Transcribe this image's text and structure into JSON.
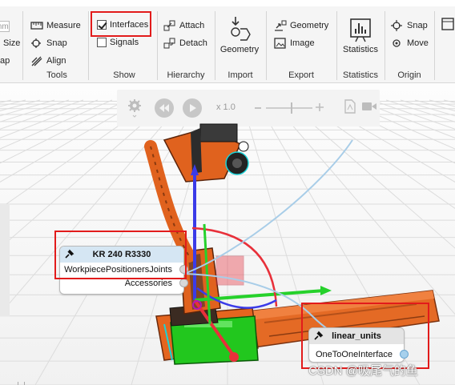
{
  "ribbon": {
    "partial": {
      "size_label": "Size",
      "map_label": "ap",
      "mm_value": "mm"
    },
    "tools": {
      "group_label": "Tools",
      "measure": "Measure",
      "snap": "Snap",
      "align": "Align"
    },
    "show": {
      "group_label": "Show",
      "interfaces": "Interfaces",
      "interfaces_checked": true,
      "signals": "Signals",
      "signals_checked": false
    },
    "hierarchy": {
      "group_label": "Hierarchy",
      "attach": "Attach",
      "detach": "Detach"
    },
    "import": {
      "group_label": "Import",
      "geometry": "Geometry"
    },
    "export": {
      "group_label": "Export",
      "geometry": "Geometry",
      "image": "Image"
    },
    "statistics": {
      "group_label": "Statistics",
      "statistics": "Statistics"
    },
    "origin": {
      "group_label": "Origin",
      "snap": "Snap",
      "move": "Move"
    }
  },
  "playback": {
    "speed": "x 1.0",
    "slider_fraction": 0.55
  },
  "nodes": {
    "robot": {
      "title": "KR 240 R3330",
      "rows": [
        "WorkpiecePositionersJoints",
        "Accessories"
      ]
    },
    "linear": {
      "title": "linear_units",
      "rows": [
        "OneToOneInterface"
      ]
    }
  },
  "watermark": "CSDN @吸尾气的鱼",
  "colors": {
    "highlight": "#e21b1b",
    "robot_orange": "#e0621e",
    "base_green": "#22c71e",
    "card_header": "#d5e6f3",
    "link_line": "#a8cde8"
  }
}
